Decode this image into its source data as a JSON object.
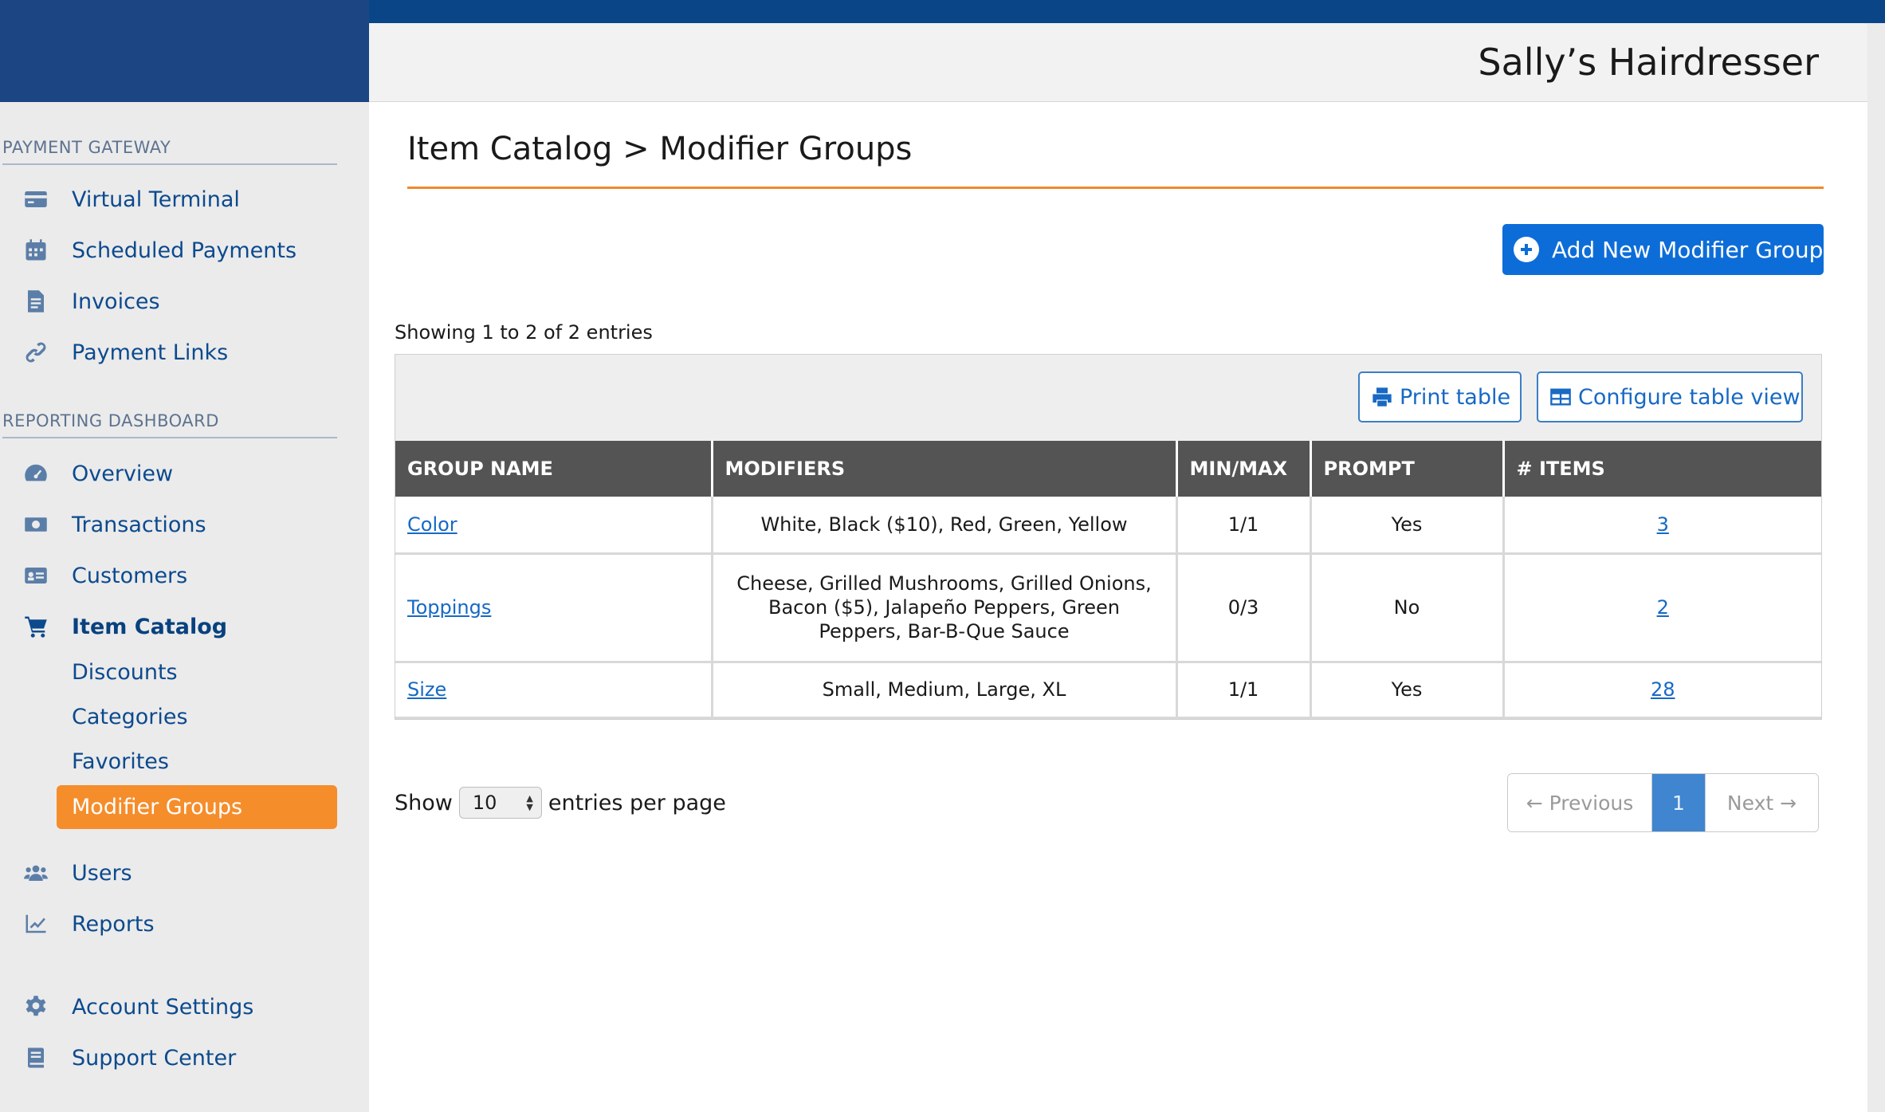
{
  "header": {
    "business_name": "Sally’s Hairdresser"
  },
  "sidebar": {
    "payment_gateway": {
      "heading": "PAYMENT GATEWAY",
      "items": [
        {
          "label": "Virtual Terminal",
          "icon": "credit-card-icon"
        },
        {
          "label": "Scheduled Payments",
          "icon": "calendar-icon"
        },
        {
          "label": "Invoices",
          "icon": "invoice-icon"
        },
        {
          "label": "Payment Links",
          "icon": "link-icon"
        }
      ]
    },
    "reporting": {
      "heading": "REPORTING DASHBOARD",
      "items": [
        {
          "label": "Overview",
          "icon": "gauge-icon"
        },
        {
          "label": "Transactions",
          "icon": "money-icon"
        },
        {
          "label": "Customers",
          "icon": "id-card-icon"
        },
        {
          "label": "Item Catalog",
          "icon": "cart-icon"
        }
      ],
      "catalog_sub": [
        "Discounts",
        "Categories",
        "Favorites",
        "Modifier Groups"
      ],
      "after": [
        {
          "label": "Users",
          "icon": "users-icon"
        },
        {
          "label": "Reports",
          "icon": "chart-line-icon"
        }
      ]
    },
    "bottom": [
      {
        "label": "Account Settings",
        "icon": "gear-icon"
      },
      {
        "label": "Support Center",
        "icon": "book-icon"
      }
    ]
  },
  "main": {
    "title": "Item Catalog > Modifier Groups",
    "add_button": "Add New Modifier Group",
    "showing": "Showing 1 to 2 of 2 entries",
    "print_button": "Print table",
    "configure_button": "Configure table view",
    "columns": [
      "GROUP NAME",
      "MODIFIERS",
      "MIN/MAX",
      "PROMPT",
      "# ITEMS"
    ],
    "rows": [
      {
        "name": "Color",
        "modifiers": "White, Black ($10), Red, Green, Yellow",
        "minmax": "1/1",
        "prompt": "Yes",
        "items": "3"
      },
      {
        "name": "Toppings",
        "modifiers": "Cheese, Grilled Mushrooms, Grilled Onions, Bacon ($5), Jalapeño Peppers, Green Peppers, Bar-B-Que Sauce",
        "minmax": "0/3",
        "prompt": "No",
        "items": "2"
      },
      {
        "name": "Size",
        "modifiers": "Small, Medium, Large, XL",
        "minmax": "1/1",
        "prompt": "Yes",
        "items": "28"
      }
    ],
    "length": {
      "show": "Show",
      "value": "10",
      "suffix": "entries per page"
    },
    "pager": {
      "previous": "← Previous",
      "current": "1",
      "next": "Next →"
    }
  },
  "colors": {
    "brand_blue": "#0a4687",
    "accent_orange": "#f58d2b",
    "button_blue": "#0d6dd8"
  }
}
